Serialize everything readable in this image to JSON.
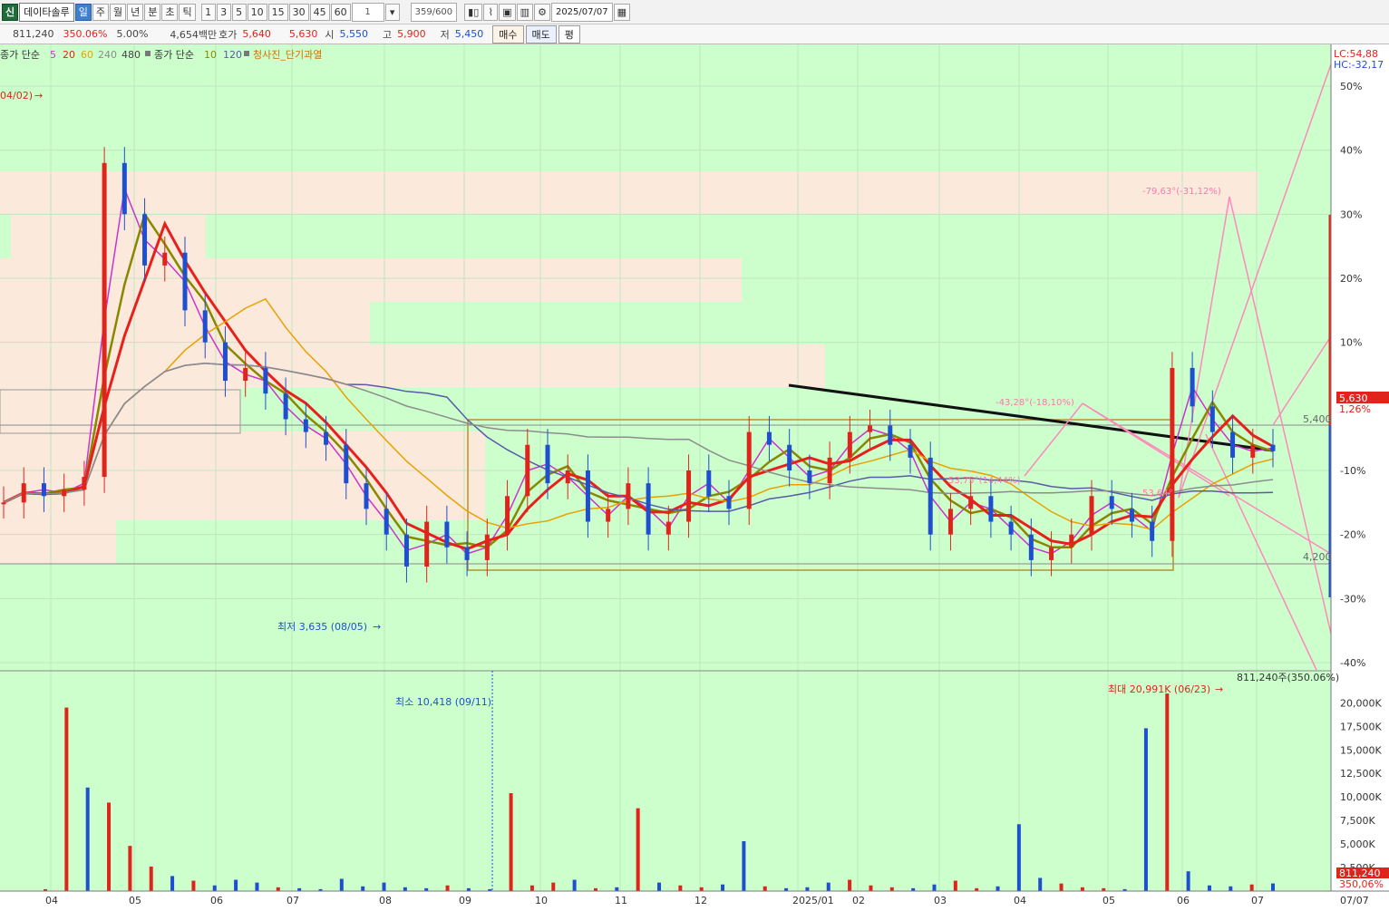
{
  "toolbar": {
    "badge": "신",
    "stock_name": "데이타솔루",
    "periods": [
      "일",
      "주",
      "월",
      "년",
      "분",
      "초",
      "틱"
    ],
    "active_period": "일",
    "intervals": [
      "1",
      "3",
      "5",
      "10",
      "15",
      "30",
      "45",
      "60"
    ],
    "count_value": "1",
    "view_range": "359/600",
    "date": "2025/07/07"
  },
  "infobar": {
    "volume": "811,240",
    "volume_ratio": "350.06%",
    "change_rate": "5.00%",
    "amount": "4,654백만",
    "quote_label": "호가",
    "ask": "5,640",
    "bid": "5,630",
    "open_label": "시",
    "open": "5,550",
    "high_label": "고",
    "high": "5,900",
    "low_label": "저",
    "low": "5,450",
    "buy_label": "매수",
    "sell_label": "매도",
    "flat_label": "평"
  },
  "legend": {
    "ma_title": "종가 단순",
    "ma_periods": [
      "5",
      "20",
      "60",
      "240",
      "480"
    ],
    "ma2_title": "종가 단순",
    "ma2_periods": [
      "10",
      "120"
    ],
    "indicator": "청사진_단기과열"
  },
  "colors": {
    "chart_bg": "#ccffcc",
    "zone": "#fbe9dc",
    "up": "#e0241b",
    "down": "#1e4fd0",
    "ma5": "#cc33cc",
    "ma10": "#888800",
    "ma20": "#e8201c",
    "ma60": "#e8a200",
    "ma120": "#5a5aa8",
    "ma240": "#8c8c8c",
    "trend": "#ff88bb"
  },
  "annotations": {
    "start_marker": "04/02)",
    "low_marker": "최저 3,635 (08/05)",
    "vol_min": "최소 10,418 (09/11)",
    "vol_max": "최대 20,991K (06/23)",
    "vol_current": "811,240주(350.06%)",
    "angle1": "-79,63°(-31,12%)",
    "angle2": "-43,28°(-18,10%)",
    "angle3": "53,75°(14,44%)",
    "angle4": "53,64°",
    "level_5400": "5,400",
    "level_4200": "4,200",
    "lc": "LC:54,88",
    "hc": "HC:-32,17",
    "price_tag": "5,630",
    "price_tag_pct": "1,26%",
    "vol_tag": "811,240",
    "vol_tag_pct": "350,06%"
  },
  "price_axis": [
    "50%",
    "40%",
    "30%",
    "20%",
    "10%",
    "-10%",
    "-20%",
    "-30%",
    "-40%"
  ],
  "volume_axis": [
    "20,000K",
    "17,500K",
    "15,000K",
    "12,500K",
    "10,000K",
    "7,500K",
    "5,000K",
    "2,500K"
  ],
  "months": [
    "04",
    "05",
    "06",
    "07",
    "08",
    "09",
    "10",
    "11",
    "12",
    "2025/01",
    "02",
    "03",
    "04",
    "05",
    "06",
    "07"
  ],
  "last_date": "07/07",
  "chart_data": {
    "type": "candlestick",
    "price_pct_range": [
      -40,
      55
    ],
    "volume_range_k": [
      0,
      21000
    ],
    "closes_pct": [
      -15,
      -12,
      -14,
      -13,
      -11,
      38,
      30,
      22,
      24,
      15,
      10,
      4,
      6,
      2,
      -2,
      -4,
      -6,
      -12,
      -16,
      -20,
      -25,
      -18,
      -22,
      -24,
      -20,
      -14,
      -6,
      -12,
      -10,
      -18,
      -16,
      -12,
      -20,
      -18,
      -10,
      -14,
      -16,
      -4,
      -6,
      -10,
      -12,
      -8,
      -4,
      -3,
      -6,
      -8,
      -20,
      -16,
      -14,
      -18,
      -20,
      -24,
      -22,
      -20,
      -14,
      -16,
      -18,
      -21,
      6,
      0,
      -4,
      -8,
      -6,
      -7
    ],
    "volumes_k": [
      200,
      19500,
      11000,
      9400,
      4800,
      2600,
      1600,
      1100,
      600,
      1200,
      900,
      400,
      300,
      200,
      1300,
      500,
      900,
      400,
      300,
      600,
      300,
      200,
      10400,
      600,
      900,
      1200,
      300,
      400,
      8800,
      900,
      600,
      400,
      700,
      5300,
      500,
      300,
      400,
      900,
      1200,
      600,
      400,
      300,
      700,
      1100,
      300,
      500,
      7100,
      1400,
      800,
      400,
      300,
      200,
      17300,
      20991,
      2100,
      600,
      500,
      700,
      811
    ]
  }
}
